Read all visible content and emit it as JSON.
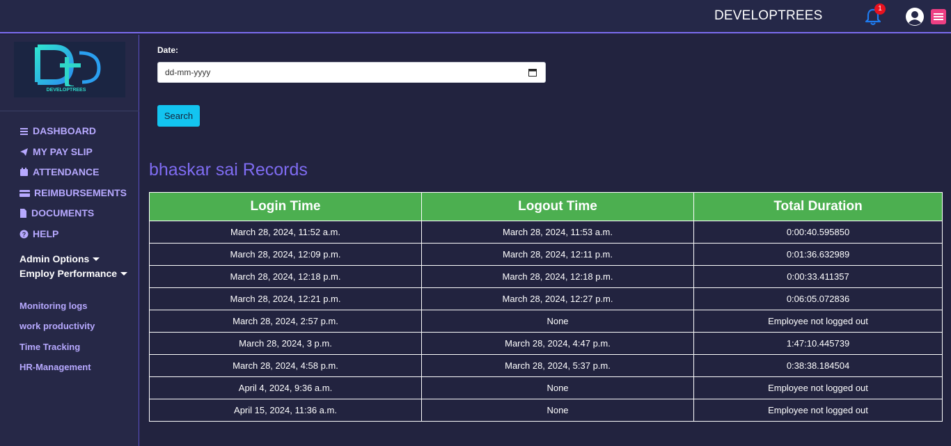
{
  "header": {
    "brand": "DEVELOPTREES",
    "notification_count": "1"
  },
  "sidebar": {
    "logo_text": "DEVELOPTREES",
    "nav": [
      {
        "label": "DASHBOARD",
        "icon": "bars-icon"
      },
      {
        "label": "MY PAY SLIP",
        "icon": "paper-plane-icon"
      },
      {
        "label": "ATTENDANCE",
        "icon": "calendar-icon"
      },
      {
        "label": "REIMBURSEMENTS",
        "icon": "credit-card-icon"
      },
      {
        "label": "DOCUMENTS",
        "icon": "file-icon"
      },
      {
        "label": "HELP",
        "icon": "question-circle-icon"
      }
    ],
    "admin": [
      {
        "label": "Admin Options"
      },
      {
        "label": "Employ Performance"
      }
    ],
    "links": [
      {
        "label": "Monitoring logs"
      },
      {
        "label": "work productivity"
      },
      {
        "label": "Time Tracking"
      },
      {
        "label": "HR-Management"
      }
    ]
  },
  "form": {
    "date_label": "Date:",
    "date_placeholder": "dd-mm-yyyy",
    "search_label": "Search"
  },
  "records": {
    "title": "bhaskar sai Records",
    "columns": [
      "Login Time",
      "Logout Time",
      "Total Duration"
    ],
    "rows": [
      [
        "March 28, 2024, 11:52 a.m.",
        "March 28, 2024, 11:53 a.m.",
        "0:00:40.595850"
      ],
      [
        "March 28, 2024, 12:09 p.m.",
        "March 28, 2024, 12:11 p.m.",
        "0:01:36.632989"
      ],
      [
        "March 28, 2024, 12:18 p.m.",
        "March 28, 2024, 12:18 p.m.",
        "0:00:33.411357"
      ],
      [
        "March 28, 2024, 12:21 p.m.",
        "March 28, 2024, 12:27 p.m.",
        "0:06:05.072836"
      ],
      [
        "March 28, 2024, 2:57 p.m.",
        "None",
        "Employee not logged out"
      ],
      [
        "March 28, 2024, 3 p.m.",
        "March 28, 2024, 4:47 p.m.",
        "1:47:10.445739"
      ],
      [
        "March 28, 2024, 4:58 p.m.",
        "March 28, 2024, 5:37 p.m.",
        "0:38:38.184504"
      ],
      [
        "April 4, 2024, 9:36 a.m.",
        "None",
        "Employee not logged out"
      ],
      [
        "April 15, 2024, 11:36 a.m.",
        "None",
        "Employee not logged out"
      ]
    ]
  },
  "colors": {
    "accent": "#7f6cf2",
    "table_header": "#4caf50",
    "search_button": "#13c4f0",
    "badge": "#e8121f",
    "menu_button": "#ee3f83"
  }
}
